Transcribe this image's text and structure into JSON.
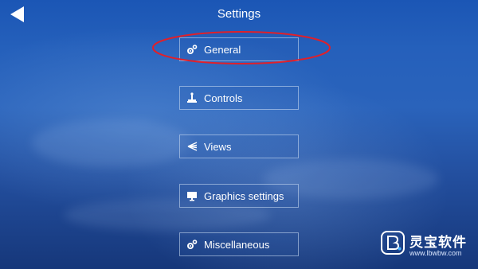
{
  "header": {
    "title": "Settings",
    "back_icon": "back-arrow-icon"
  },
  "menu": {
    "items": [
      {
        "label": "General",
        "icon": "gears-icon"
      },
      {
        "label": "Controls",
        "icon": "joystick-icon"
      },
      {
        "label": "Views",
        "icon": "views-fan-icon"
      },
      {
        "label": "Graphics settings",
        "icon": "monitor-icon"
      },
      {
        "label": "Miscellaneous",
        "icon": "gears-icon"
      }
    ],
    "highlighted_index": 0
  },
  "watermark": {
    "brand": "灵宝软件",
    "url": "www.lbwbw.com"
  },
  "colors": {
    "highlight": "#e0202a",
    "text": "#ffffff",
    "button_border": "#c8d8f0",
    "sky_top": "#1b56b5",
    "sky_bottom": "#16377a"
  }
}
